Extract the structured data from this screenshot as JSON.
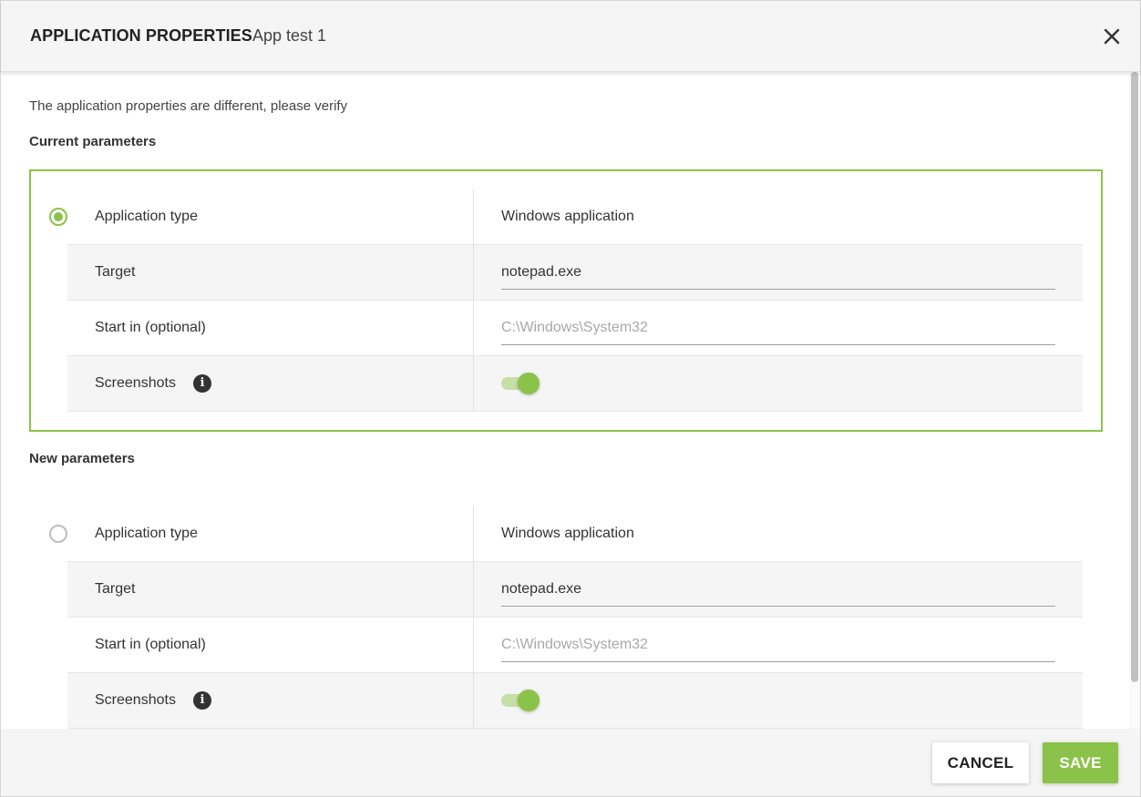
{
  "header": {
    "title": "APPLICATION PROPERTIES",
    "subtitle": "App test 1",
    "close_icon": "close-icon"
  },
  "notice": "The application properties are different, please verify",
  "current": {
    "label": "Current parameters",
    "selected": true,
    "rows": {
      "app_type_label": "Application type",
      "app_type_value": "Windows application",
      "target_label": "Target",
      "target_value": "notepad.exe",
      "start_in_label": "Start in (optional)",
      "start_in_placeholder": "C:\\Windows\\System32",
      "screenshots_label": "Screenshots",
      "screenshots_enabled": true
    }
  },
  "new": {
    "label": "New parameters",
    "selected": false,
    "rows": {
      "app_type_label": "Application type",
      "app_type_value": "Windows application",
      "target_label": "Target",
      "target_value": "notepad.exe",
      "start_in_label": "Start in (optional)",
      "start_in_placeholder": "C:\\Windows\\System32",
      "screenshots_label": "Screenshots",
      "screenshots_enabled": true
    }
  },
  "footer": {
    "cancel_label": "CANCEL",
    "save_label": "SAVE"
  },
  "colors": {
    "accent": "#8bc34a",
    "accent_light": "#c5dfa6"
  }
}
